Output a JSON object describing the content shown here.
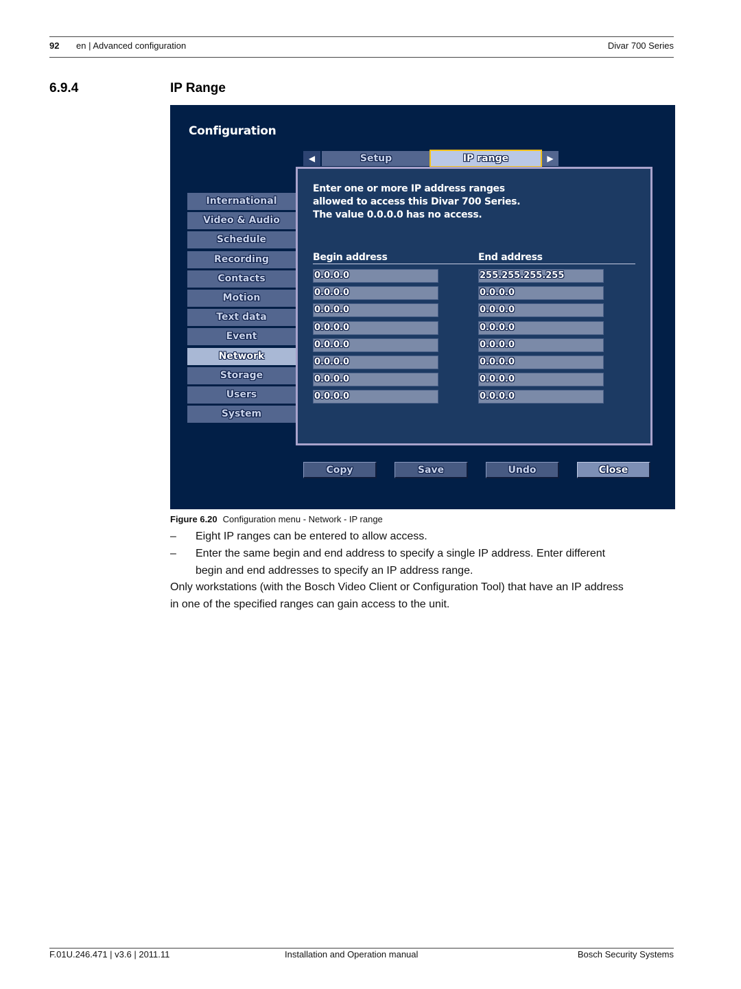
{
  "header": {
    "page_number": "92",
    "section_path": "en | Advanced configuration",
    "product": "Divar 700 Series"
  },
  "section": {
    "number": "6.9.4",
    "title": "IP Range"
  },
  "screen": {
    "title": "Configuration",
    "tabs": {
      "prev_icon": "◀",
      "setup": "Setup",
      "ip_range": "IP range",
      "next_icon": "▶",
      "active": "IP range"
    },
    "message": [
      "Enter one or more IP address ranges",
      "allowed to access this Divar 700 Series.",
      "The value 0.0.0.0 has no access."
    ],
    "columns": {
      "begin": "Begin address",
      "end": "End address"
    },
    "ranges": [
      {
        "begin": "0.0.0.0",
        "end": "255.255.255.255"
      },
      {
        "begin": "0.0.0.0",
        "end": "0.0.0.0"
      },
      {
        "begin": "0.0.0.0",
        "end": "0.0.0.0"
      },
      {
        "begin": "0.0.0.0",
        "end": "0.0.0.0"
      },
      {
        "begin": "0.0.0.0",
        "end": "0.0.0.0"
      },
      {
        "begin": "0.0.0.0",
        "end": "0.0.0.0"
      },
      {
        "begin": "0.0.0.0",
        "end": "0.0.0.0"
      },
      {
        "begin": "0.0.0.0",
        "end": "0.0.0.0"
      }
    ],
    "sidebar": [
      {
        "label": "International"
      },
      {
        "label": "Video & Audio"
      },
      {
        "label": "Schedule"
      },
      {
        "label": "Recording"
      },
      {
        "label": "Contacts"
      },
      {
        "label": "Motion"
      },
      {
        "label": "Text data"
      },
      {
        "label": "Event"
      },
      {
        "label": "Network",
        "active": true
      },
      {
        "label": "Storage"
      },
      {
        "label": "Users"
      },
      {
        "label": "System"
      }
    ],
    "buttons": {
      "copy": "Copy",
      "save": "Save",
      "undo": "Undo",
      "close": "Close"
    },
    "colors": {
      "background": "#021f47",
      "panel": "#1c3a63",
      "tab_highlight_border": "#f3c21b",
      "active_item": "#a9b8d5"
    }
  },
  "caption": {
    "label": "Figure  6.20",
    "text": "Configuration menu - Network - IP range"
  },
  "body": {
    "bullets": [
      "Eight IP ranges can be entered to allow access.",
      "Enter the same begin and end address to specify a single IP address. Enter different",
      "begin and end addresses to specify an IP address range."
    ],
    "bullet_dash": "–",
    "paragraph": [
      "Only workstations (with the Bosch Video Client or Configuration Tool) that have an IP address",
      "in one of the specified ranges can gain access to the unit."
    ]
  },
  "footer": {
    "doc_id": "F.01U.246.471 | v3.6 | 2011.11",
    "doc_type": "Installation and Operation manual",
    "company": "Bosch Security Systems"
  }
}
